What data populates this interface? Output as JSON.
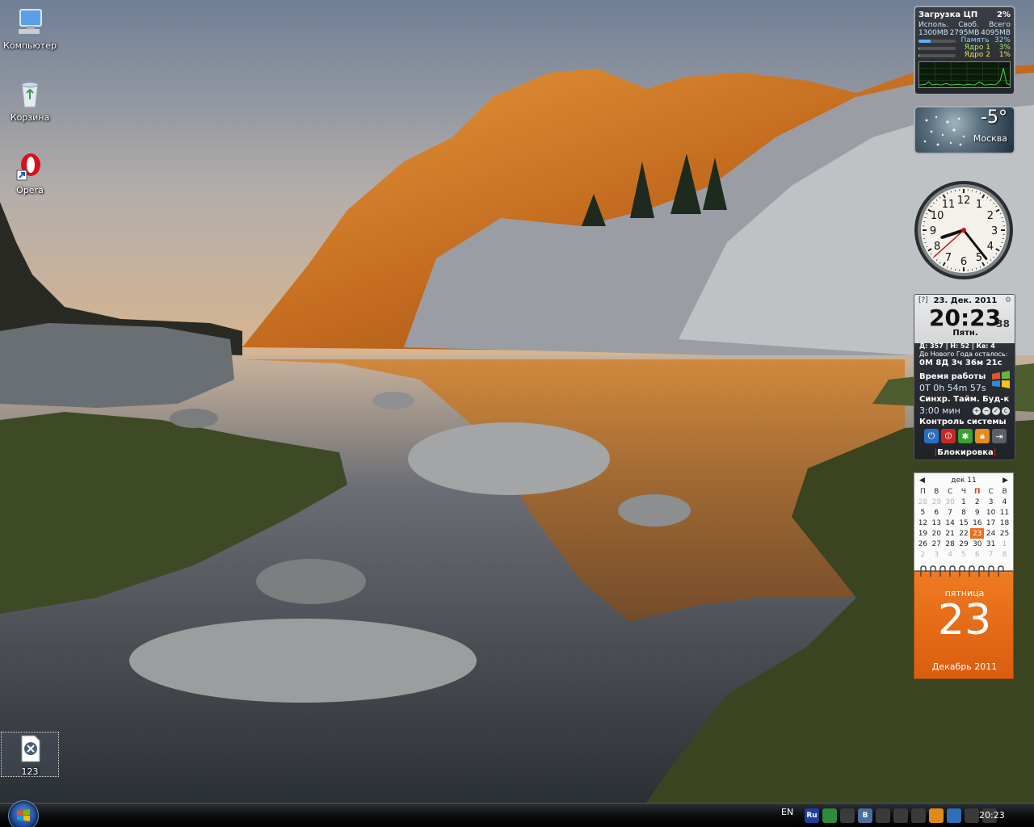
{
  "desktop": {
    "icons": [
      {
        "label": "Компьютер",
        "icon": "computer-icon"
      },
      {
        "label": "Корзина",
        "icon": "recycle-bin-icon"
      },
      {
        "label": "Opera",
        "icon": "opera-icon"
      },
      {
        "label": "123",
        "icon": "document-icon"
      }
    ]
  },
  "cpu_gadget": {
    "title": "Загрузка ЦП",
    "cpu_percent": "2%",
    "col_used": "Исполь.",
    "col_free": "Своб.",
    "col_total": "Всего",
    "used": "1300MB",
    "free": "2795MB",
    "total": "4095MB",
    "memory_label": "Память",
    "memory_value": "32%",
    "memory_fraction": 0.32,
    "core1_label": "Ядро 1",
    "core1_value": "3%",
    "core1_fraction": 0.03,
    "core2_label": "Ядро 2",
    "core2_value": "1%",
    "core2_fraction": 0.01
  },
  "weather_gadget": {
    "temperature": "-5°",
    "city": "Москва"
  },
  "clock_gadget": {
    "numerals": [
      "12",
      "1",
      "2",
      "3",
      "4",
      "5",
      "6",
      "7",
      "8",
      "9",
      "10",
      "11"
    ],
    "hour": 20,
    "minute": 23,
    "second": 38
  },
  "sysmon_gadget": {
    "help": "[?]",
    "date": "23. Дек. 2011",
    "time": "20:23",
    "seconds": "38",
    "day_of_week": "Пятн.",
    "day_stats": "Д: 357 |",
    "week_stats": "Н: 52 |",
    "quarter_stats": "Кв: 4",
    "new_year_label": "До Нового Года осталось:",
    "new_year_countdown": "0М  8Д  3ч  36м  21с",
    "uptime_label": "Время работы",
    "uptime_value": "0Т 0h 54m 57s",
    "sync_label": "Синхр.  Тайм.  Буд-к",
    "timer_value": "3:00 мин",
    "control_label": "Контроль системы",
    "lock_label": "Блокировка"
  },
  "calendar_gadget": {
    "month_label": "дек 11",
    "weekdays": [
      "П",
      "В",
      "С",
      "Ч",
      "П",
      "С",
      "В"
    ],
    "weeks": [
      [
        {
          "d": "28",
          "o": true
        },
        {
          "d": "29",
          "o": true
        },
        {
          "d": "30",
          "o": true
        },
        {
          "d": "1"
        },
        {
          "d": "2"
        },
        {
          "d": "3"
        },
        {
          "d": "4"
        }
      ],
      [
        {
          "d": "5"
        },
        {
          "d": "6"
        },
        {
          "d": "7"
        },
        {
          "d": "8"
        },
        {
          "d": "9"
        },
        {
          "d": "10"
        },
        {
          "d": "11"
        }
      ],
      [
        {
          "d": "12"
        },
        {
          "d": "13"
        },
        {
          "d": "14"
        },
        {
          "d": "15"
        },
        {
          "d": "16"
        },
        {
          "d": "17"
        },
        {
          "d": "18"
        }
      ],
      [
        {
          "d": "19"
        },
        {
          "d": "20"
        },
        {
          "d": "21"
        },
        {
          "d": "22"
        },
        {
          "d": "23",
          "t": true
        },
        {
          "d": "24"
        },
        {
          "d": "25"
        }
      ],
      [
        {
          "d": "26"
        },
        {
          "d": "27"
        },
        {
          "d": "28"
        },
        {
          "d": "29"
        },
        {
          "d": "30"
        },
        {
          "d": "31"
        },
        {
          "d": "1",
          "o": true
        }
      ],
      [
        {
          "d": "2",
          "o": true
        },
        {
          "d": "3",
          "o": true
        },
        {
          "d": "4",
          "o": true
        },
        {
          "d": "5",
          "o": true
        },
        {
          "d": "6",
          "o": true
        },
        {
          "d": "7",
          "o": true
        },
        {
          "d": "8",
          "o": true
        }
      ]
    ]
  },
  "daypage_gadget": {
    "day_of_week": "пятница",
    "day": "23",
    "month_year": "Декабрь 2011"
  },
  "taskbar": {
    "language": "EN",
    "tray_icons": [
      {
        "icon": "language-ru-icon",
        "label": "Ru",
        "color": "#1f3f9a"
      },
      {
        "icon": "chat-icon",
        "label": "",
        "color": "#2e8b3c"
      },
      {
        "icon": "network-activity-icon",
        "label": "",
        "color": "#3b3b3b"
      },
      {
        "icon": "vk-icon",
        "label": "В",
        "color": "#4a6f9e"
      },
      {
        "icon": "notification-icon",
        "label": "",
        "color": "#3a3a3a"
      },
      {
        "icon": "user-status-icon",
        "label": "",
        "color": "#3a3a3a"
      },
      {
        "icon": "update-icon",
        "label": "",
        "color": "#3a3a3a"
      },
      {
        "icon": "antivirus-icon",
        "label": "",
        "color": "#e08a1b"
      },
      {
        "icon": "settings-icon",
        "label": "",
        "color": "#2d6fb8"
      },
      {
        "icon": "volume-icon",
        "label": "",
        "color": "#3a3a3a"
      },
      {
        "icon": "network-icon",
        "label": "",
        "color": "#3a3a3a"
      }
    ],
    "clock": "20:23"
  }
}
